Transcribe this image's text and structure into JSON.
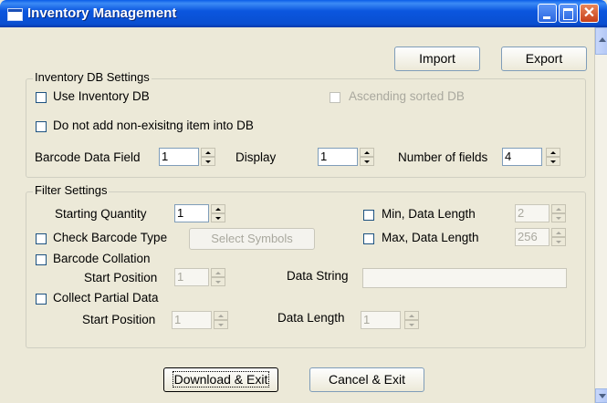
{
  "window": {
    "title": "Inventory Management"
  },
  "toolbar": {
    "import_label": "Import",
    "export_label": "Export"
  },
  "inventory_db": {
    "group_label": "Inventory DB Settings",
    "use_inventory_db": {
      "label": "Use Inventory DB",
      "checked": false
    },
    "ascending_sorted": {
      "label": "Ascending sorted DB",
      "checked": false,
      "enabled": false
    },
    "no_add_nonexisting": {
      "label": "Do not add non-exisitng item into DB",
      "checked": false
    },
    "barcode_data_field": {
      "label": "Barcode Data Field",
      "value": "1"
    },
    "display": {
      "label": "Display",
      "value": "1"
    },
    "number_of_fields": {
      "label": "Number of fields",
      "value": "4"
    }
  },
  "filter": {
    "group_label": "Filter Settings",
    "starting_quantity": {
      "label": "Starting Quantity",
      "value": "1"
    },
    "min_data_length": {
      "label": "Min, Data Length",
      "value": "2",
      "checked": false
    },
    "max_data_length": {
      "label": "Max, Data Length",
      "value": "256",
      "checked": false
    },
    "check_barcode_type": {
      "label": "Check Barcode Type",
      "checked": false
    },
    "select_symbols_label": "Select Symbols",
    "barcode_collation": {
      "label": "Barcode Collation",
      "checked": false
    },
    "collation_start_position": {
      "label": "Start Position",
      "value": "1"
    },
    "data_string": {
      "label": "Data String",
      "value": ""
    },
    "collect_partial_data": {
      "label": "Collect Partial Data",
      "checked": false
    },
    "partial_start_position": {
      "label": "Start Position",
      "value": "1"
    },
    "data_length": {
      "label": "Data Length",
      "value": "1"
    }
  },
  "actions": {
    "download_exit_label": "Download & Exit",
    "cancel_exit_label": "Cancel & Exit"
  }
}
